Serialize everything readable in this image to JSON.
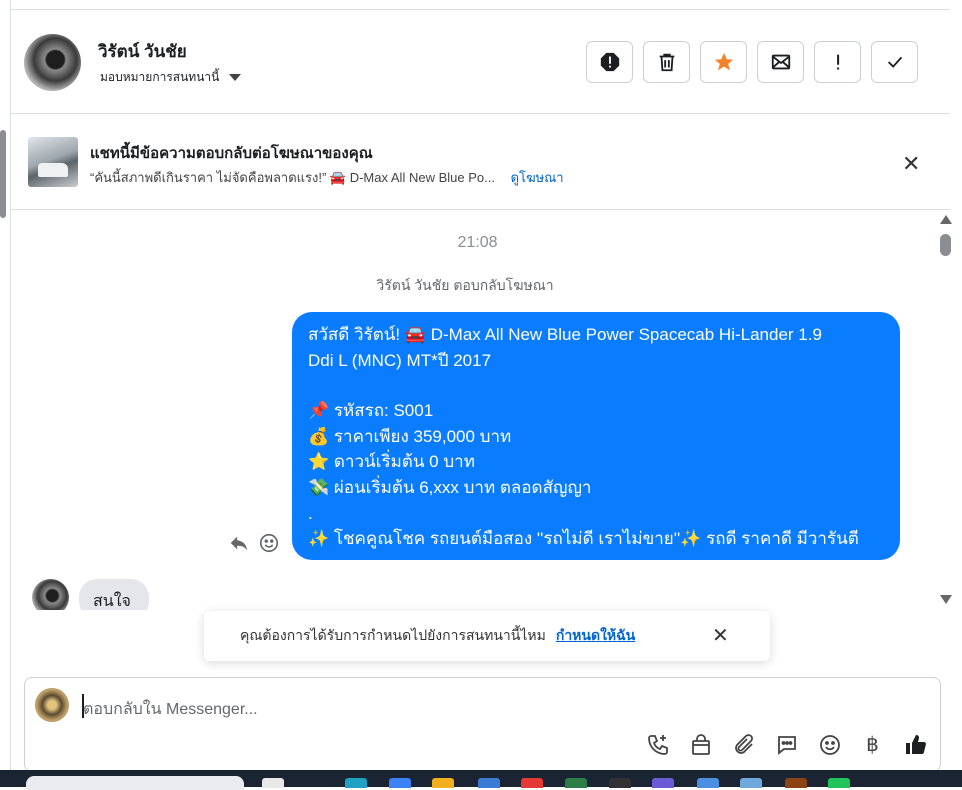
{
  "header": {
    "contact_name": "วิรัตน์ วันชัย",
    "assign_label": "มอบหมายการสนทนานี้",
    "toolbar": [
      {
        "name": "report-button",
        "icon": "alert-octagon-icon"
      },
      {
        "name": "delete-button",
        "icon": "trash-icon"
      },
      {
        "name": "star-button",
        "icon": "star-icon"
      },
      {
        "name": "mark-unread-button",
        "icon": "envelope-icon"
      },
      {
        "name": "follow-up-button",
        "icon": "exclamation-icon"
      },
      {
        "name": "done-button",
        "icon": "check-icon"
      }
    ],
    "star_color": "#f5822a"
  },
  "ad_banner": {
    "title": "แชทนี้มีข้อความตอบกลับต่อโฆษณาของคุณ",
    "snippet": "“คันนี้สภาพดีเกินราคา ไม่จัดคือพลาดแรง!” 🚘 D-Max All New Blue Po...",
    "view_ad_label": "ดูโฆษณา",
    "close_symbol": "✕"
  },
  "chat": {
    "timestamp": "21:08",
    "reply_notice": "วิรัตน์ วันชัย ตอบกลับโฆษณา",
    "outgoing_lines": [
      "สวัสดี วิรัตน์! 🚘 D-Max All New Blue Power Spacecab Hi-Lander 1.9",
      "Ddi L (MNC) MT*ปี 2017",
      "",
      "📌 รหัสรถ: S001",
      "💰 ราคาเพียง 359,000 บาท",
      "⭐ ดาวน์เริ่มต้น 0 บาท",
      "💸 ผ่อนเริ่มต้น 6,xxx บาท ตลอดสัญญา",
      ".",
      "✨ โชคคูณโชค รถยนต์มือสอง ''รถไม่ดี เราไม่ขาย''✨ รถดี ราคาดี มีวารันตี"
    ],
    "bubble_color": "#0a7cff",
    "incoming_message": "สนใจ"
  },
  "assign_toast": {
    "text": "คุณต้องการได้รับการกำหนดไปยังการสนทนานี้ไหม",
    "link": "กำหนดให้ฉัน",
    "close_symbol": "✕"
  },
  "composer": {
    "placeholder": "ตอบกลับใน Messenger...",
    "tools": [
      "phone-plus-icon",
      "shopping-bag-icon",
      "paperclip-icon",
      "saved-replies-icon",
      "emoji-icon",
      "baht-icon",
      "thumbs-up-icon"
    ],
    "baht_symbol": "฿"
  }
}
